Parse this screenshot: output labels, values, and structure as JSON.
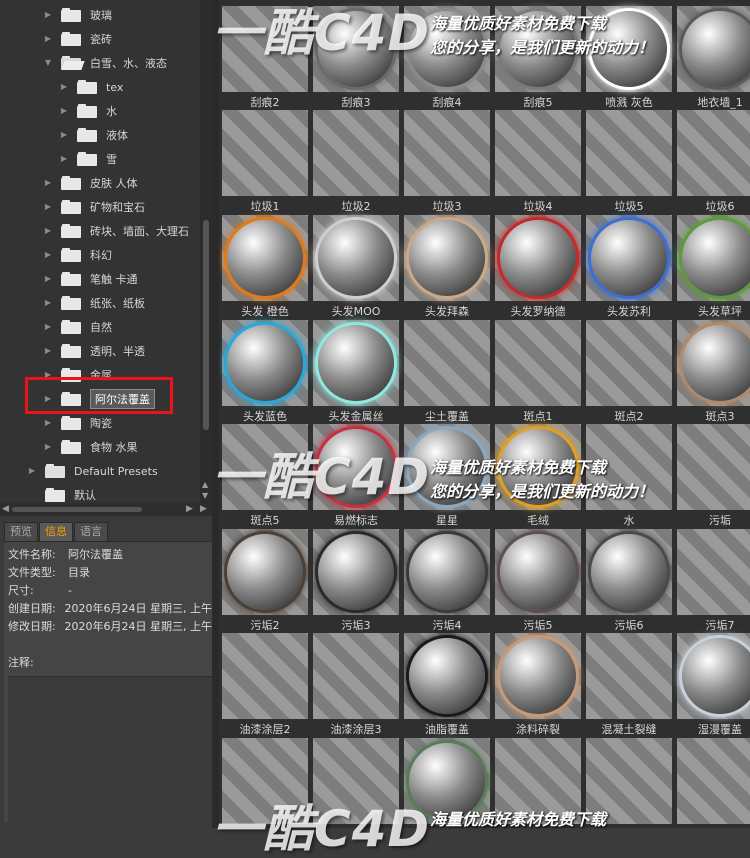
{
  "tree": {
    "items": [
      {
        "label": "玻璃",
        "indent": 1,
        "open": false
      },
      {
        "label": "瓷砖",
        "indent": 1,
        "open": false
      },
      {
        "label": "白雪、水、液态",
        "indent": 1,
        "open": true
      },
      {
        "label": "tex",
        "indent": 2,
        "open": false
      },
      {
        "label": "水",
        "indent": 2,
        "open": false
      },
      {
        "label": "液体",
        "indent": 2,
        "open": false
      },
      {
        "label": "雪",
        "indent": 2,
        "open": false
      },
      {
        "label": "皮肤 人体",
        "indent": 1,
        "open": false
      },
      {
        "label": "矿物和宝石",
        "indent": 1,
        "open": false
      },
      {
        "label": "砖块、墙面、大理石",
        "indent": 1,
        "open": false
      },
      {
        "label": "科幻",
        "indent": 1,
        "open": false
      },
      {
        "label": "笔触 卡通",
        "indent": 1,
        "open": false
      },
      {
        "label": "纸张、纸板",
        "indent": 1,
        "open": false
      },
      {
        "label": "自然",
        "indent": 1,
        "open": false
      },
      {
        "label": "透明、半透",
        "indent": 1,
        "open": false
      },
      {
        "label": "金属",
        "indent": 1,
        "open": false
      },
      {
        "label": "阿尔法覆盖",
        "indent": 1,
        "open": false,
        "selected": true
      },
      {
        "label": "陶瓷",
        "indent": 1,
        "open": false
      },
      {
        "label": "食物 水果",
        "indent": 1,
        "open": false
      },
      {
        "label": "Default Presets",
        "indent": 0,
        "open": false,
        "preset": true
      },
      {
        "label": "默认",
        "indent": 0,
        "open": false
      }
    ]
  },
  "info": {
    "tabs": [
      "预览",
      "信息",
      "语言"
    ],
    "active_tab": "信息",
    "rows": [
      {
        "key": "文件名称:",
        "value": "阿尔法覆盖"
      },
      {
        "key": "文件类型:",
        "value": "目录"
      },
      {
        "key": "尺寸:",
        "value": "-"
      },
      {
        "key": "创建日期:",
        "value": "2020年6月24日 星期三, 上午"
      },
      {
        "key": "修改日期:",
        "value": "2020年6月24日 星期三, 上午"
      }
    ],
    "notes_label": "注释:"
  },
  "grid": {
    "rows": [
      [
        "刮痕2",
        "刮痕3",
        "刮痕4",
        "刮痕5",
        "喷溅 灰色",
        "地衣墙_1"
      ],
      [
        "垃圾1",
        "垃圾2",
        "垃圾3",
        "垃圾4",
        "垃圾5",
        "垃圾6"
      ],
      [
        "头发 橙色",
        "头发MOO",
        "头发拜森",
        "头发罗纳德",
        "头发苏利",
        "头发草坪"
      ],
      [
        "头发蓝色",
        "头发金属丝",
        "尘土覆盖",
        "斑点1",
        "斑点2",
        "斑点3"
      ],
      [
        "斑点5",
        "易燃标志",
        "星星",
        "毛绒",
        "水",
        "污垢"
      ],
      [
        "污垢2",
        "污垢3",
        "污垢4",
        "污垢5",
        "污垢6",
        "污垢7"
      ],
      [
        "油漆涂层2",
        "油漆涂层3",
        "油脂覆盖",
        "涂料碎裂",
        "混凝土裂缝",
        "湿漫覆盖"
      ],
      [
        "",
        "",
        "",
        "",
        "",
        ""
      ]
    ],
    "sphere_colors": [
      [
        "",
        "#6a6a6a",
        "#8a8a8a",
        "#7a7a7a",
        "#ffffff",
        "#5a5a5a"
      ],
      [
        "",
        "",
        "",
        "",
        "",
        ""
      ],
      [
        "#e07a1c",
        "#cfcfcf",
        "#c9a98a",
        "#c42a2a",
        "#3d6fd1",
        "#5e9a3a"
      ],
      [
        "#2aa8d8",
        "#8fe8e0",
        "",
        "",
        "",
        "#b08a6a"
      ],
      [
        "",
        "#c83040",
        "#8aa8c0",
        "#e0a020",
        "",
        ""
      ],
      [
        "#4a4036",
        "#2a2a2a",
        "#3a3a3a",
        "#5a5050",
        "#4a4a4a",
        ""
      ],
      [
        "",
        "",
        "#1a1a1a",
        "#c89a78",
        "",
        "#c8d0d8"
      ],
      [
        "",
        "",
        "#5a7a5a",
        "",
        "",
        ""
      ]
    ]
  },
  "watermark": {
    "logo": "一酷C4D",
    "line1": "海量优质好素材免费下载",
    "line2": "您的分享，是我们更新的动力！"
  }
}
